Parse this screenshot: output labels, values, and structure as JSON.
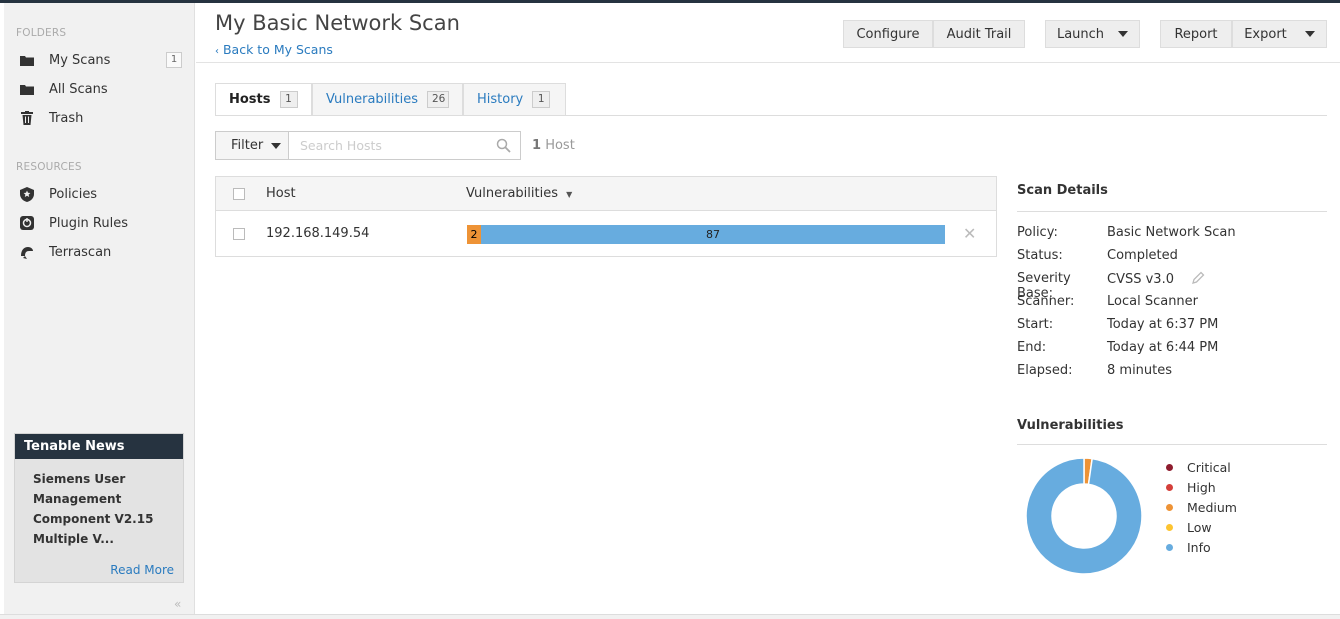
{
  "sidebar": {
    "folders_heading": "FOLDERS",
    "folders": [
      {
        "label": "My Scans",
        "count": "1",
        "icon": "folder-icon"
      },
      {
        "label": "All Scans",
        "icon": "folder-icon"
      },
      {
        "label": "Trash",
        "icon": "trash-icon"
      }
    ],
    "resources_heading": "RESOURCES",
    "resources": [
      {
        "label": "Policies",
        "icon": "policy-shield-icon"
      },
      {
        "label": "Plugin Rules",
        "icon": "plugin-rules-icon"
      },
      {
        "label": "Terrascan",
        "icon": "terrascan-icon"
      }
    ],
    "news": {
      "title": "Tenable News",
      "headline": "Siemens User Management Component V2.15 Multiple V...",
      "read_more": "Read More"
    },
    "collapse_glyph": "«"
  },
  "header": {
    "title": "My Basic Network Scan",
    "back_link": "Back to My Scans",
    "buttons": {
      "configure": "Configure",
      "audit_trail": "Audit Trail",
      "launch": "Launch",
      "report": "Report",
      "export": "Export"
    }
  },
  "tabs": [
    {
      "label": "Hosts",
      "count": "1",
      "active": true
    },
    {
      "label": "Vulnerabilities",
      "count": "26",
      "active": false
    },
    {
      "label": "History",
      "count": "1",
      "active": false
    }
  ],
  "toolbar": {
    "filter_label": "Filter",
    "search_placeholder": "Search Hosts",
    "host_count_number": "1",
    "host_count_label": "Host"
  },
  "table": {
    "columns": {
      "host": "Host",
      "vulnerabilities": "Vulnerabilities"
    },
    "rows": [
      {
        "host": "192.168.149.54",
        "medium": "2",
        "info": "87"
      }
    ]
  },
  "scan_details": {
    "title": "Scan Details",
    "rows": [
      {
        "key": "Policy:",
        "value": "Basic Network Scan"
      },
      {
        "key": "Status:",
        "value": "Completed"
      },
      {
        "key": "Severity Base:",
        "value": "CVSS v3.0"
      },
      {
        "key": "Scanner:",
        "value": "Local Scanner"
      },
      {
        "key": "Start:",
        "value": "Today at 6:37 PM"
      },
      {
        "key": "End:",
        "value": "Today at 6:44 PM"
      },
      {
        "key": "Elapsed:",
        "value": "8 minutes"
      }
    ]
  },
  "vulnerabilities_panel": {
    "title": "Vulnerabilities",
    "legend": [
      {
        "label": "Critical",
        "color": "#8e1c2e"
      },
      {
        "label": "High",
        "color": "#d43f3a"
      },
      {
        "label": "Medium",
        "color": "#ee9336"
      },
      {
        "label": "Low",
        "color": "#fdc431"
      },
      {
        "label": "Info",
        "color": "#67acdf"
      }
    ]
  },
  "chart_data": {
    "type": "pie",
    "categories": [
      "Critical",
      "High",
      "Medium",
      "Low",
      "Info"
    ],
    "values": [
      0,
      0,
      2,
      0,
      87
    ],
    "colors": [
      "#8e1c2e",
      "#d43f3a",
      "#ee9336",
      "#fdc431",
      "#67acdf"
    ],
    "title": "Vulnerabilities",
    "legend": "right"
  },
  "colors": {
    "accent": "#2a7bbf",
    "dark": "#263340"
  }
}
